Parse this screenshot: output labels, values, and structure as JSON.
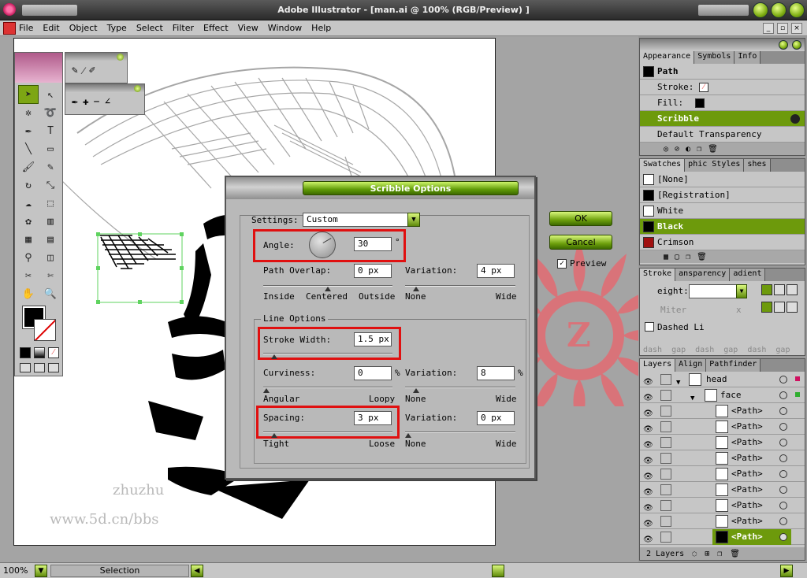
{
  "window": {
    "title": "Adobe Illustrator - [man.ai @ 100% (RGB/Preview) ]"
  },
  "menu": [
    "File",
    "Edit",
    "Object",
    "Type",
    "Select",
    "Filter",
    "Effect",
    "View",
    "Window",
    "Help"
  ],
  "watermark": {
    "line1": "zhuzhu",
    "line2": "www.5d.cn/bbs"
  },
  "dialog": {
    "title": "Scribble Options",
    "settings_label": "Settings:",
    "settings_value": "Custom",
    "angle_label": "Angle:",
    "angle_value": "30",
    "angle_unit": "°",
    "path_overlap_label": "Path Overlap:",
    "path_overlap_value": "0 px",
    "variation_label": "Variation:",
    "path_overlap_variation": "4 px",
    "slider_inside": "Inside",
    "slider_centered": "Centered",
    "slider_outside": "Outside",
    "slider_none": "None",
    "slider_wide": "Wide",
    "line_options_label": "Line Options",
    "stroke_width_label": "Stroke Width:",
    "stroke_width_value": "1.5 px",
    "curviness_label": "Curviness:",
    "curviness_value": "0",
    "percent": "%",
    "curviness_variation": "8",
    "slider_angular": "Angular",
    "slider_loopy": "Loopy",
    "spacing_label": "Spacing:",
    "spacing_value": "3 px",
    "spacing_variation": "0 px",
    "slider_tight": "Tight",
    "slider_loose": "Loose",
    "ok_label": "OK",
    "cancel_label": "Cancel",
    "preview_label": "Preview",
    "preview_checked": true
  },
  "appearance_panel": {
    "tabs": [
      "Appearance",
      "Symbols",
      "Info"
    ],
    "path_label": "Path",
    "stroke_label": "Stroke:",
    "fill_label": "Fill:",
    "scribble_label": "Scribble",
    "transparency_label": "Default Transparency"
  },
  "swatches_panel": {
    "tabs": [
      "Swatches",
      "phic Styles",
      "shes"
    ],
    "items": [
      {
        "name": "[None]",
        "color": "#ffffff"
      },
      {
        "name": "[Registration]",
        "color": "#000000"
      },
      {
        "name": "White",
        "color": "#ffffff"
      },
      {
        "name": "Black",
        "color": "#000000"
      },
      {
        "name": "Crimson",
        "color": "#a01010"
      }
    ]
  },
  "stroke_panel": {
    "tabs": [
      "Stroke",
      "ansparency",
      "adient"
    ],
    "weight_label": "eight:",
    "miter_label": "Miter",
    "miter_x": "x",
    "dashed_label": "Dashed Li",
    "dash_labels": [
      "dash",
      "gap",
      "dash",
      "gap",
      "dash",
      "gap"
    ]
  },
  "layers_panel": {
    "tabs": [
      "Layers",
      "Align",
      "Pathfinder"
    ],
    "layer_name": "head",
    "sublayer_name": "face",
    "path_items": [
      "<Path>",
      "<Path>",
      "<Path>",
      "<Path>",
      "<Path>",
      "<Path>",
      "<Path>",
      "<Path>",
      "<Path>"
    ],
    "count_label": "2 Layers",
    "colors": {
      "layer": "#d01060",
      "sublayer": "#2fae2f",
      "selected": "#6d9a0c"
    }
  },
  "status": {
    "zoom": "100%",
    "tool": "Selection"
  },
  "colors": {
    "accent": "#6d9a0c",
    "highlight_box": "#e01010"
  }
}
